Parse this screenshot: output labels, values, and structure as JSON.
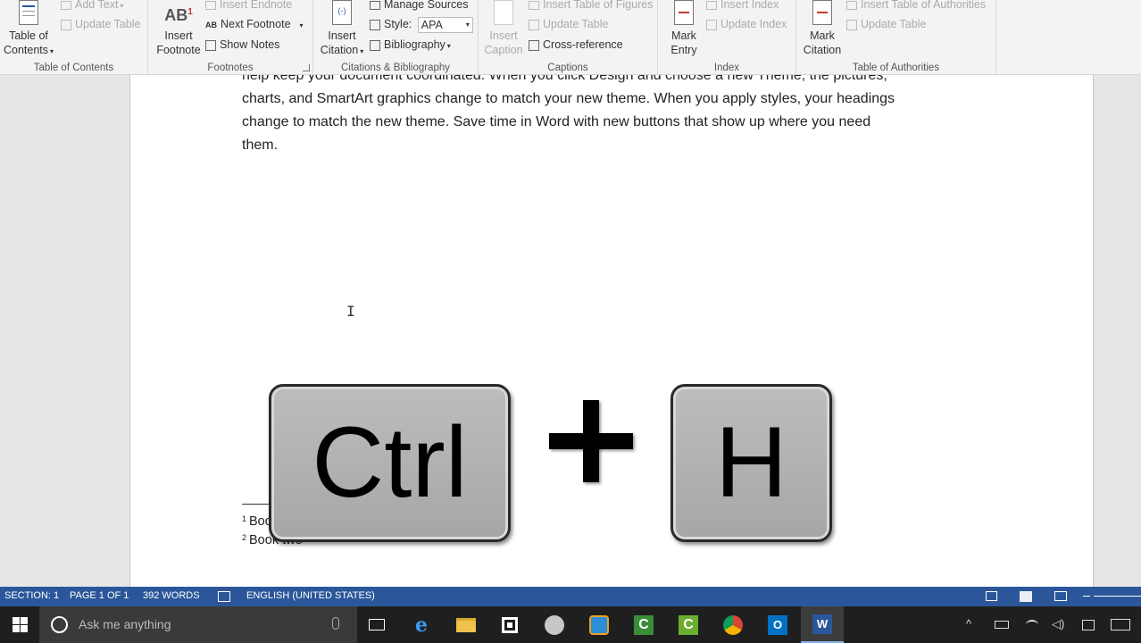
{
  "ribbon": {
    "toc": {
      "btn": "Table of Contents",
      "btn_line1": "Table of",
      "btn_line2": "Contents",
      "add_text": "Add Text",
      "update_table": "Update Table",
      "group": "Table of Contents"
    },
    "footnotes": {
      "insert_footnote_line1": "Insert",
      "insert_footnote_line2": "Footnote",
      "insert_endnote": "Insert Endnote",
      "next_footnote": "Next Footnote",
      "show_notes": "Show Notes",
      "group": "Footnotes"
    },
    "citations": {
      "insert_citation_line1": "Insert",
      "insert_citation_line2": "Citation",
      "manage_sources": "Manage Sources",
      "style_label": "Style:",
      "style_value": "APA",
      "bibliography": "Bibliography",
      "group": "Citations & Bibliography"
    },
    "captions": {
      "insert_caption_line1": "Insert",
      "insert_caption_line2": "Caption",
      "insert_tof": "Insert Table of Figures",
      "update_table": "Update Table",
      "cross_reference": "Cross-reference",
      "group": "Captions"
    },
    "index": {
      "mark_entry_line1": "Mark",
      "mark_entry_line2": "Entry",
      "insert_index": "Insert Index",
      "update_index": "Update Index",
      "group": "Index"
    },
    "toa": {
      "mark_citation_line1": "Mark",
      "mark_citation_line2": "Citation",
      "insert_toa": "Insert Table of Authorities",
      "update_table": "Update Table",
      "group": "Table of Authorities"
    }
  },
  "document": {
    "lines": [
      "help keep your document coordinated.  When you click Design and choose a new Theme, the pictures,",
      "charts, and SmartArt graphics change to match your new theme. When you apply styles, your headings",
      "change to match the new theme. Save time in Word with new buttons that show up where you need",
      "them."
    ],
    "footnotes": [
      {
        "num": "1",
        "text": "Book one"
      },
      {
        "num": "2",
        "text": "Book two"
      }
    ]
  },
  "overlay": {
    "key1": "Ctrl",
    "plus": "+",
    "key2": "H"
  },
  "status": {
    "section": "SECTION: 1",
    "page": "PAGE 1 OF 1",
    "words": "392 WORDS",
    "language": "ENGLISH (UNITED STATES)"
  },
  "taskbar": {
    "search_placeholder": "Ask me anything"
  },
  "colors": {
    "word_blue": "#2b579a",
    "taskbar": "#1f1f1f"
  }
}
